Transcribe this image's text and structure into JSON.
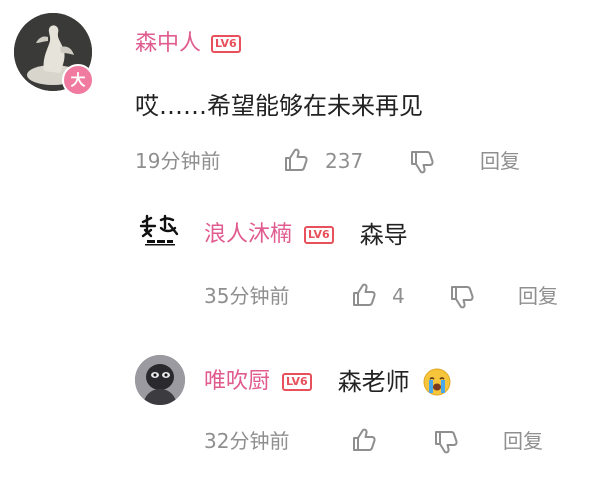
{
  "comments": [
    {
      "username": "森中人",
      "level": "LV6",
      "avatar_icon": "sculpture-avatar",
      "badge_text": "大",
      "text": "哎……希望能够在未来再见",
      "time": "19分钟前",
      "like_count": "237",
      "reply_label": "回复"
    }
  ],
  "replies": [
    {
      "username": "浪人沐楠",
      "level": "LV6",
      "avatar_icon": "calligraphy-logo-avatar",
      "text": "森导",
      "time": "35分钟前",
      "like_count": "4",
      "reply_label": "回复"
    },
    {
      "username": "唯吹厨",
      "level": "LV6",
      "avatar_icon": "photo-avatar",
      "text": "森老师",
      "emoji": "crying-face-emoji",
      "time": "32分钟前",
      "like_count": "",
      "reply_label": "回复"
    }
  ],
  "colors": {
    "username": "#e05c8f",
    "level_badge": "#e8505b",
    "meta_text": "#8f8f8f",
    "content_text": "#222222"
  }
}
